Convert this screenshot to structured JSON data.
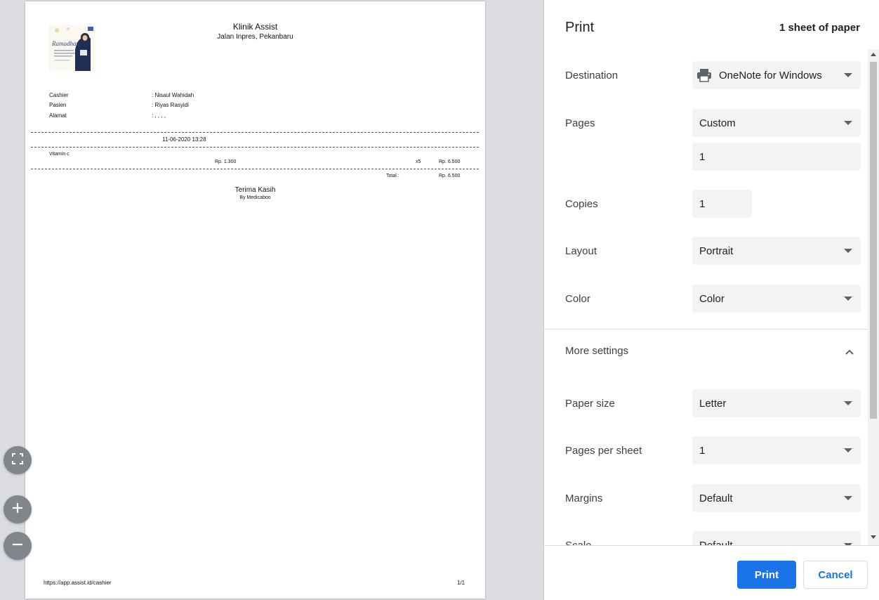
{
  "preview": {
    "clinic_name": "Klinik Assist",
    "clinic_address": "Jalan Inpres, Pekanbaru",
    "logo_text": "Ramadhan",
    "receipt": {
      "cashier_label": "Cashier",
      "cashier_value": ":  Nisaul Wahidah",
      "patient_label": "Pasien",
      "patient_value": ":  Riyas Rasyidi",
      "address_label": "Alamat",
      "address_value": ": , , , ,",
      "datetime": "11-06-2020 13:28",
      "item_name": "Vitamin c",
      "item_price": "Rp. 1.300",
      "item_qty": "x5",
      "item_subtotal": "Rp. 6.500",
      "total_label": "Total :",
      "total_value": "Rp. 6.500",
      "thanks": "Terima Kasih",
      "by": "By Medicaboo"
    },
    "footer_url": "https://app.assist.id/cashier",
    "footer_page": "1/1"
  },
  "zoom": {
    "fit_icon": "fit-to-page-icon",
    "zoom_in_icon": "plus-icon",
    "zoom_out_icon": "minus-icon"
  },
  "sidebar": {
    "title": "Print",
    "sheet_count": "1 sheet of paper",
    "destination_label": "Destination",
    "destination_value": "OneNote for Windows",
    "pages_label": "Pages",
    "pages_value": "Custom",
    "pages_custom_value": "1",
    "copies_label": "Copies",
    "copies_value": "1",
    "layout_label": "Layout",
    "layout_value": "Portrait",
    "color_label": "Color",
    "color_value": "Color",
    "more_settings_label": "More settings",
    "paper_size_label": "Paper size",
    "paper_size_value": "Letter",
    "pages_per_sheet_label": "Pages per sheet",
    "pages_per_sheet_value": "1",
    "margins_label": "Margins",
    "margins_value": "Default",
    "scale_label": "Scale",
    "scale_value": "Default",
    "print_button": "Print",
    "cancel_button": "Cancel"
  },
  "colors": {
    "accent": "#1a73e8",
    "control_bg": "#f1f3f4",
    "preview_bg": "#dadce0"
  }
}
